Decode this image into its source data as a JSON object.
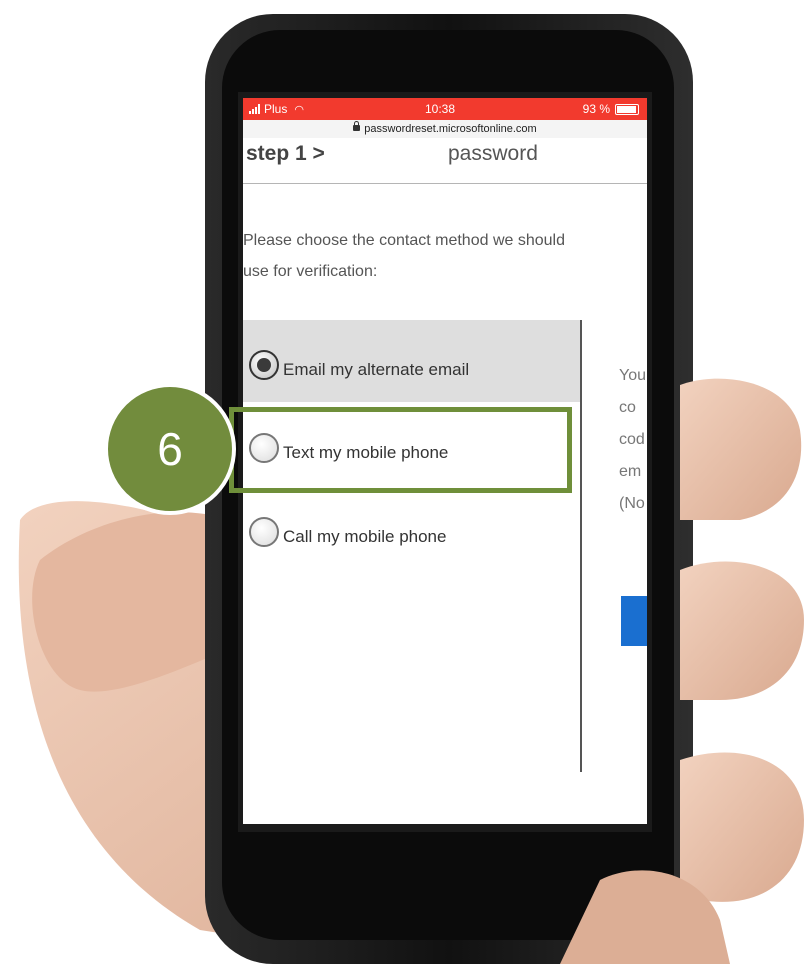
{
  "status_bar": {
    "carrier": "Plus",
    "time": "10:38",
    "battery": "93 %"
  },
  "browser": {
    "url": "passwordreset.microsoftonline.com"
  },
  "page": {
    "step_label": "step 1 >",
    "step_title": "password",
    "instructions_line1": "Please choose the contact method we should",
    "instructions_line2": "use for verification:",
    "options": [
      {
        "label": "Email my alternate email",
        "selected": true
      },
      {
        "label": "Text my mobile phone",
        "selected": false
      },
      {
        "label": "Call my mobile phone",
        "selected": false
      }
    ],
    "right_text": [
      "You",
      "co",
      "cod",
      "em",
      "(No"
    ]
  },
  "annotation": {
    "step_number": "6",
    "highlight_color": "#6f8f3a"
  },
  "colors": {
    "status_bar": "#f23a2e",
    "badge": "#728c3d",
    "next_button": "#1a6fd0"
  }
}
